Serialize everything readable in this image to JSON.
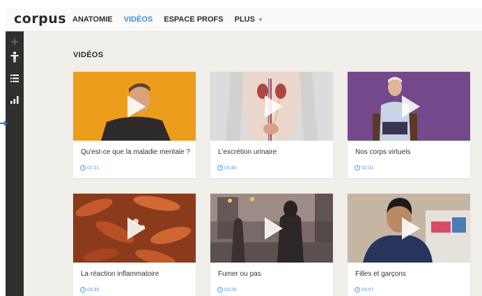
{
  "brand": {
    "logo_text": "corpus"
  },
  "nav": {
    "items": [
      {
        "label": "ANATOMIE",
        "active": false
      },
      {
        "label": "VIDÉOS",
        "active": true
      },
      {
        "label": "ESPACE PROFS",
        "active": false
      },
      {
        "label": "PLUS",
        "active": false,
        "has_dropdown": true
      }
    ]
  },
  "sidebar": {
    "icons": [
      "plus-icon",
      "person-icon",
      "list-icon",
      "bar-chart-icon"
    ]
  },
  "section": {
    "title": "VIDÉOS"
  },
  "videos": [
    {
      "title": "Qu'est-ce que la maladie mentale ?",
      "duration": "02:21"
    },
    {
      "title": "L'excrétion urinaire",
      "duration": "03:40"
    },
    {
      "title": "Nos corps virtuels",
      "duration": "02:01"
    },
    {
      "title": "La réaction inflammatoire",
      "duration": "03:40"
    },
    {
      "title": "Fumer ou pas",
      "duration": "03:28"
    },
    {
      "title": "Filles et garçons",
      "duration": "03:07"
    }
  ],
  "colors": {
    "accent": "#3f8fd2",
    "sidebar_bg": "#2f2f2f",
    "page_bg": "#f1efea",
    "duration_text": "#5c9be0"
  }
}
